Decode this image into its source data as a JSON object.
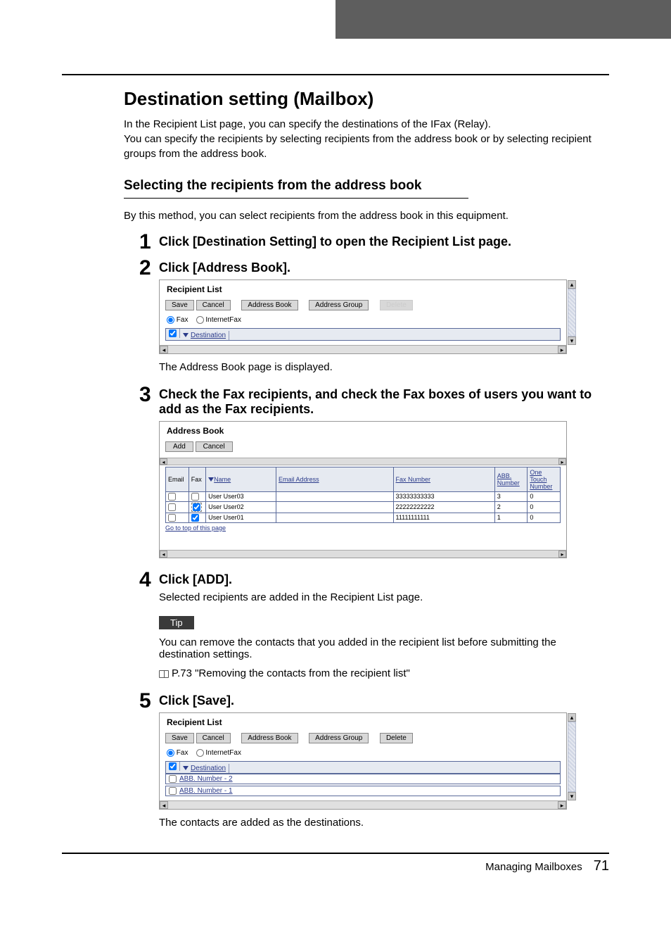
{
  "title": "Destination setting (Mailbox)",
  "intro_p1": "In the Recipient List page, you can specify the destinations of the IFax (Relay).",
  "intro_p2": "You can specify the recipients by selecting recipients from the address book or by selecting recipient groups from the address book.",
  "subsection": "Selecting the recipients from the address book",
  "sub_intro": "By this method, you can select recipients from the address book in this equipment.",
  "steps": {
    "s1": {
      "num": "1",
      "title": "Click [Destination Setting] to open the Recipient List page."
    },
    "s2": {
      "num": "2",
      "title": "Click [Address Book].",
      "after": "The Address Book page is displayed."
    },
    "s3": {
      "num": "3",
      "title": "Check the Fax recipients, and check the Fax boxes of users you want to add as the Fax recipients."
    },
    "s4": {
      "num": "4",
      "title": "Click [ADD].",
      "desc": "Selected recipients are added in the Recipient List page."
    },
    "s5": {
      "num": "5",
      "title": "Click [Save].",
      "after": "The contacts are added as the destinations."
    }
  },
  "tip_label": "Tip",
  "tip_text": "You can remove the contacts that you added in the recipient list before submitting the destination settings.",
  "tip_ref": "P.73 \"Removing the contacts from the recipient list\"",
  "recipient_list": {
    "header": "Recipient List",
    "buttons": {
      "save": "Save",
      "cancel": "Cancel",
      "address_book": "Address Book",
      "address_group": "Address Group",
      "delete": "Delete"
    },
    "radio_fax": "Fax",
    "radio_ifax": "InternetFax",
    "dest_label": "Destination",
    "rows_saved": [
      {
        "label": "ABB. Number - 2"
      },
      {
        "label": "ABB. Number - 1"
      }
    ]
  },
  "address_book": {
    "header": "Address Book",
    "buttons": {
      "add": "Add",
      "cancel": "Cancel"
    },
    "cols": {
      "email": "Email",
      "fax": "Fax",
      "name": "Name",
      "email_addr": "Email Address",
      "fax_num": "Fax Number",
      "abb": "ABB. Number",
      "one_touch": "One Touch Number"
    },
    "rows": [
      {
        "name": "User User03",
        "email": "",
        "fax": "33333333333",
        "abb": "3",
        "ot": "0",
        "fax_checked": false
      },
      {
        "name": "User User02",
        "email": "",
        "fax": "22222222222",
        "abb": "2",
        "ot": "0",
        "fax_checked": true
      },
      {
        "name": "User User01",
        "email": "",
        "fax": "11111111111",
        "abb": "1",
        "ot": "0",
        "fax_checked": true
      }
    ],
    "gotop": "Go to top of this page"
  },
  "footer": {
    "section": "Managing Mailboxes",
    "page": "71"
  }
}
